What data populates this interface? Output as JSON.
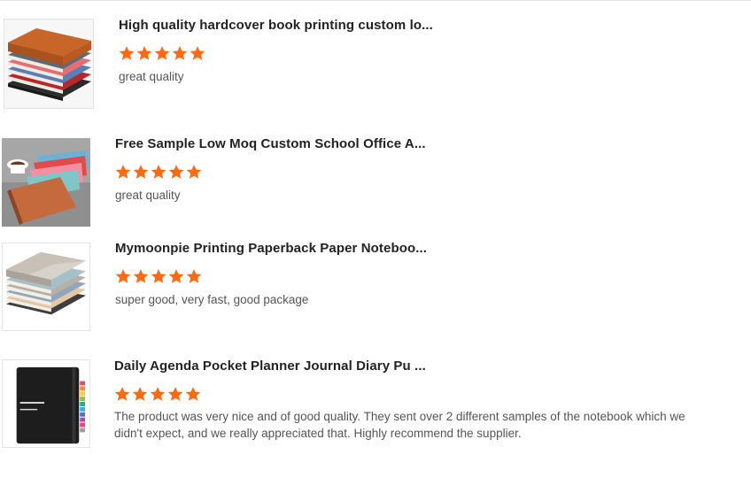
{
  "colors": {
    "star": "#ff6a13",
    "star_empty": "#dddddd",
    "title": "#222222",
    "comment": "#555555",
    "border": "#e3e3e3"
  },
  "reviews": [
    {
      "title": "High quality hardcover book printing custom lo...",
      "rating": 5,
      "rating_max": 5,
      "comment": "great quality",
      "thumbnail_icon": "brown-leather-notebooks-stack-image"
    },
    {
      "title": "Free Sample Low Moq Custom School Office A...",
      "rating": 5,
      "rating_max": 5,
      "comment": "great quality",
      "thumbnail_icon": "colorful-notebooks-with-coffee-image"
    },
    {
      "title": "Mymoonpie Printing Paperback Paper Noteboo...",
      "rating": 5,
      "rating_max": 5,
      "comment": "super good, very fast, good package",
      "thumbnail_icon": "pastel-notebooks-stack-image"
    },
    {
      "title": "Daily Agenda Pocket Planner Journal Diary Pu ...",
      "rating": 5,
      "rating_max": 5,
      "comment": "The product was very nice and of good quality. They sent over 2 different samples of the notebook which we didn't expect, and we really appreciated that. Highly recommend the supplier.",
      "thumbnail_icon": "black-planner-with-tabs-image"
    }
  ]
}
